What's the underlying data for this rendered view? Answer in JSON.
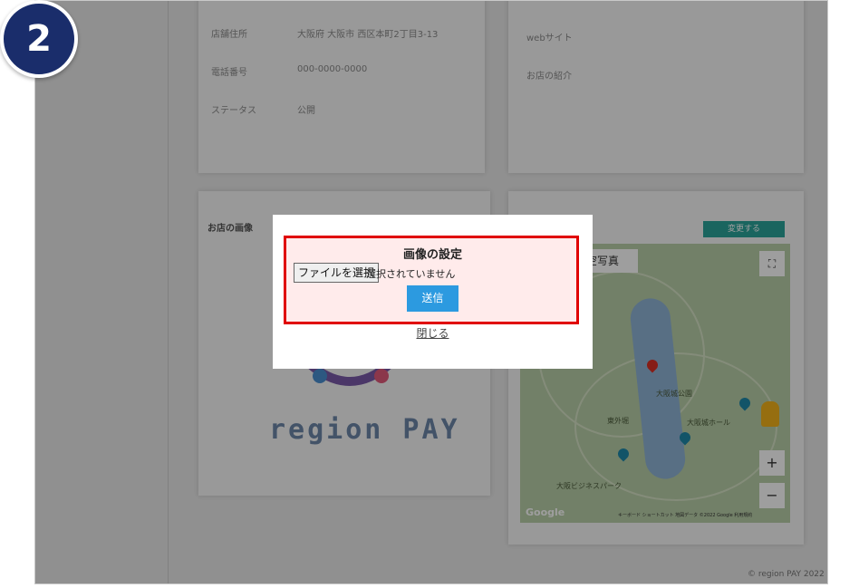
{
  "step_badge": "2",
  "store_info": {
    "rows": [
      {
        "label": "店舗住所",
        "value": "大阪府 大阪市 西区本町2丁目3-13"
      },
      {
        "label": "電話番号",
        "value": "000-0000-0000"
      },
      {
        "label": "ステータス",
        "value": "公開"
      }
    ],
    "website_label": "webサイト",
    "intro_label": "お店の紹介"
  },
  "image_section": {
    "title": "お店の画像",
    "logo_text": "region PAY"
  },
  "map": {
    "change_button": "変更する",
    "photo_label": "航空写真",
    "zoom_in": "+",
    "zoom_out": "−",
    "google": "Google",
    "attribution": "キーボード ショートカット  地図データ ©2022 Google  利用規約",
    "places": [
      "大阪城公園",
      "東外堀",
      "大阪城ホール",
      "大阪ビジネスパーク"
    ]
  },
  "footer": "© region PAY 2022",
  "modal": {
    "title": "画像の設定",
    "file_button": "ファイルを選択",
    "file_status": "選択されていません",
    "submit": "送信",
    "close": "閉じる"
  },
  "colors": {
    "badge": "#1a2d6b",
    "highlight": "#e00000",
    "submit": "#2c9ae0",
    "change_button": "#2aa39a"
  }
}
